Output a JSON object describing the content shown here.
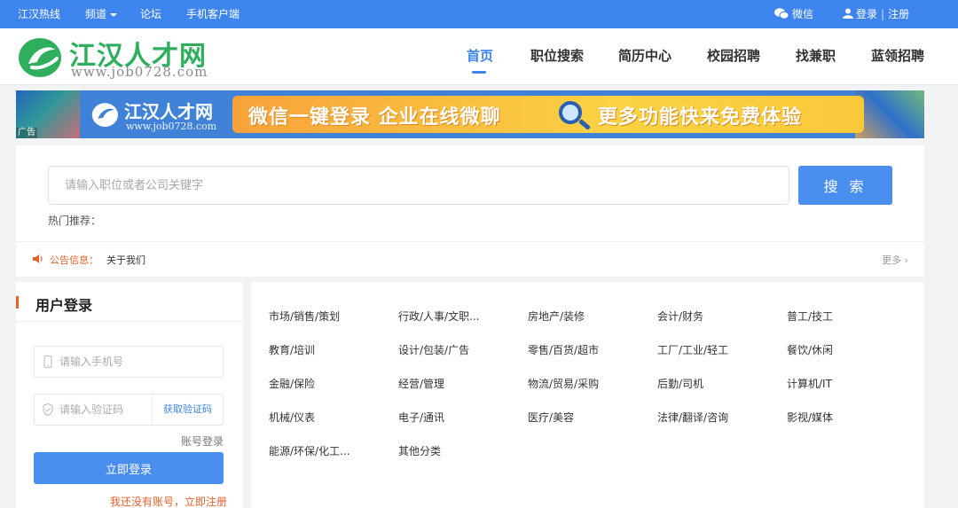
{
  "topbar": {
    "hotline": "江汉热线",
    "channel": "频道",
    "forum": "论坛",
    "mobile": "手机客户端",
    "wechat": "微信",
    "login": "登录",
    "register": "注册"
  },
  "header": {
    "logo_title": "江汉人才网",
    "logo_url": "www.job0728.com",
    "nav": [
      "首页",
      "职位搜索",
      "简历中心",
      "校园招聘",
      "找兼职",
      "蓝领招聘"
    ],
    "active_index": 0
  },
  "banner": {
    "logo_title": "江汉人才网",
    "logo_url": "www.job0728.com",
    "slogan_a": "微信一键登录 企业在线微聊",
    "slogan_b": "更多功能快来免费体验",
    "ad_tag": "广告"
  },
  "search": {
    "placeholder": "请输入职位或者公司关键字",
    "button": "搜 索",
    "hot_label": "热门推荐："
  },
  "notice": {
    "label": "公告信息：",
    "link": "关于我们",
    "more": "更多 ›"
  },
  "login": {
    "title": "用户登录",
    "phone_placeholder": "请输入手机号",
    "code_placeholder": "请输入验证码",
    "get_code": "获取验证码",
    "account_login": "账号登录",
    "submit": "立即登录",
    "no_account": "我还没有账号，立即注册"
  },
  "categories": [
    "市场/销售/策划",
    "行政/人事/文职...",
    "房地产/装修",
    "会计/财务",
    "普工/技工",
    "教育/培训",
    "设计/包装/广告",
    "零售/百货/超市",
    "工厂/工业/轻工",
    "餐饮/休闲",
    "金融/保险",
    "经营/管理",
    "物流/贸易/采购",
    "后勤/司机",
    "计算机/IT",
    "机械/仪表",
    "电子/通讯",
    "医疗/美容",
    "法律/翻译/咨询",
    "影视/媒体",
    "能源/环保/化工...",
    "其他分类"
  ],
  "colors": {
    "primary": "#3d84ee",
    "brand_green": "#2fae5e",
    "accent_orange": "#e8602c"
  }
}
